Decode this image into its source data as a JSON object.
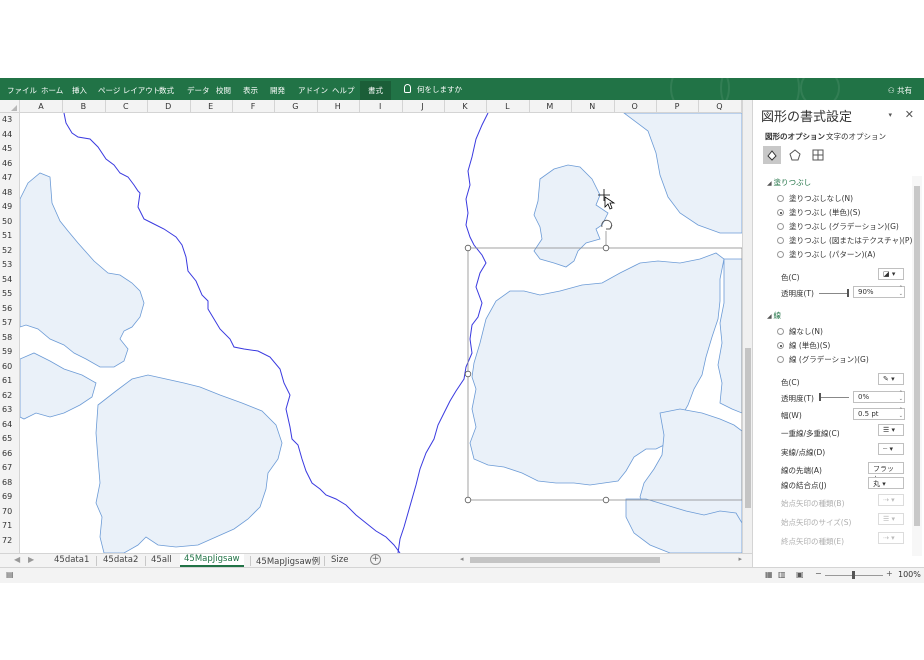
{
  "ribbon": {
    "tabs": [
      "ファイル",
      "ホーム",
      "挿入",
      "ページ レイアウト",
      "数式",
      "データ",
      "校閲",
      "表示",
      "開発",
      "アドイン",
      "ヘルプ",
      "書式"
    ],
    "active_tab": "書式",
    "tell_me": "何をしますか",
    "share": "共有"
  },
  "columns": [
    "A",
    "B",
    "C",
    "D",
    "E",
    "F",
    "G",
    "H",
    "I",
    "J",
    "K",
    "L",
    "M",
    "N",
    "O",
    "P",
    "Q"
  ],
  "rows": [
    "43",
    "44",
    "45",
    "46",
    "47",
    "48",
    "49",
    "50",
    "51",
    "52",
    "53",
    "54",
    "55",
    "56",
    "57",
    "58",
    "59",
    "60",
    "61",
    "62",
    "63",
    "64",
    "65",
    "66",
    "67",
    "68",
    "69",
    "70",
    "71",
    "72"
  ],
  "sheets": [
    "45data1",
    "45data2",
    "45all",
    "45MapJigsaw",
    "45MapJigsaw例",
    "Size"
  ],
  "active_sheet": "45MapJigsaw",
  "status": {
    "zoom": "100%"
  },
  "pane": {
    "title": "図形の書式設定",
    "tabs": [
      "図形のオプション",
      "文字のオプション"
    ],
    "fill": {
      "header": "塗りつぶし",
      "options": [
        "塗りつぶしなし(N)",
        "塗りつぶし (単色)(S)",
        "塗りつぶし (グラデーション)(G)",
        "塗りつぶし (図またはテクスチャ)(P)",
        "塗りつぶし (パターン)(A)"
      ],
      "selected": 1,
      "color_label": "色(C)",
      "transparency_label": "透明度(T)",
      "transparency_value": "90%"
    },
    "line": {
      "header": "線",
      "options": [
        "線なし(N)",
        "線 (単色)(S)",
        "線 (グラデーション)(G)"
      ],
      "selected": 1,
      "color_label": "色(C)",
      "transparency_label": "透明度(T)",
      "transparency_value": "0%",
      "width_label": "幅(W)",
      "width_value": "0.5 pt",
      "compound_label": "一重線/多重線(C)",
      "dash_label": "実線/点線(D)",
      "cap_label": "線の先端(A)",
      "cap_value": "フラット",
      "join_label": "線の結合点(J)",
      "join_value": "丸",
      "begin_arrow_type_label": "始点矢印の種類(B)",
      "begin_arrow_size_label": "始点矢印のサイズ(S)",
      "end_arrow_type_label": "終点矢印の種類(E)"
    }
  },
  "colors": {
    "ribbon": "#217346",
    "region_fill": "#eaf1f9",
    "region_stroke": "#6c9bd6",
    "river": "#3a3ae0"
  }
}
